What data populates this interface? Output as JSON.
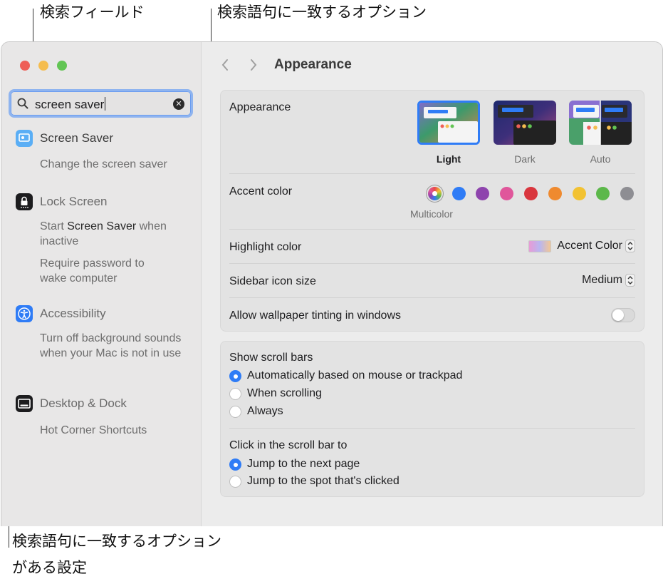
{
  "callouts": {
    "search_field": "検索フィールド",
    "matching_options": "検索語句に一致するオプション",
    "settings_line1": "検索語句に一致するオプション",
    "settings_line2": "がある設定"
  },
  "search": {
    "value": "screen saver"
  },
  "sidebar": {
    "categories": [
      {
        "label": "Screen Saver",
        "icon": "screen-saver-icon",
        "options": [
          "Change the screen saver"
        ]
      },
      {
        "label": "Lock Screen",
        "icon": "lock-icon",
        "options": [
          "Start Screen Saver when inactive",
          "Require password to wake computer"
        ]
      },
      {
        "label": "Accessibility",
        "icon": "accessibility-icon",
        "options": [
          "Turn off background sounds when your Mac is not in use"
        ]
      },
      {
        "label": "Desktop & Dock",
        "icon": "dock-icon",
        "options": [
          "Hot Corner Shortcuts"
        ]
      }
    ],
    "lock_option_1a": "Start ",
    "lock_option_1b": "Screen Saver",
    "lock_option_1c": " when inactive"
  },
  "main": {
    "title": "Appearance",
    "appearance": {
      "label": "Appearance",
      "options": [
        {
          "label": "Light",
          "selected": true
        },
        {
          "label": "Dark",
          "selected": false
        },
        {
          "label": "Auto",
          "selected": false
        }
      ]
    },
    "accent": {
      "label": "Accent color",
      "selected_name": "Multicolor",
      "colors": [
        "multicolor",
        "#2f7cf6",
        "#8e44ad",
        "#e0569b",
        "#d9363e",
        "#ef8a2f",
        "#f2c232",
        "#5cb84a",
        "#8e8e93"
      ]
    },
    "highlight": {
      "label": "Highlight color",
      "value": "Accent Color"
    },
    "sidebar_icon_size": {
      "label": "Sidebar icon size",
      "value": "Medium"
    },
    "wallpaper_tinting": {
      "label": "Allow wallpaper tinting in windows",
      "on": false
    },
    "scroll_bars": {
      "label": "Show scroll bars",
      "options": [
        "Automatically based on mouse or trackpad",
        "When scrolling",
        "Always"
      ],
      "selected": 0
    },
    "click_scroll": {
      "label": "Click in the scroll bar to",
      "options": [
        "Jump to the next page",
        "Jump to the spot that's clicked"
      ],
      "selected": 0
    }
  }
}
